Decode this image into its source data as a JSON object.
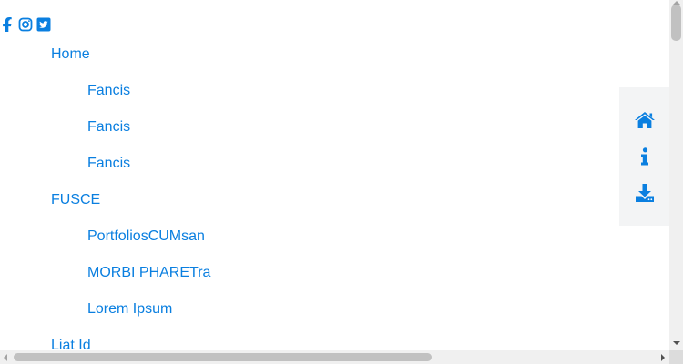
{
  "social": {
    "icons": [
      "facebook-icon",
      "instagram-icon",
      "twitter-icon"
    ],
    "color": "#0a7fe0"
  },
  "nav": {
    "home": {
      "label": "Home",
      "children": [
        "Fancis",
        "Fancis",
        "Fancis"
      ]
    },
    "fusce": {
      "label": "FUSCE",
      "children": [
        "PortfoliosCUMsan",
        "MORBI PHARETra",
        "Lorem Ipsum"
      ]
    },
    "liat": {
      "label": "Liat Id"
    }
  },
  "side_panel": {
    "icons": [
      "home-icon",
      "info-icon",
      "download-icon"
    ],
    "icon_color": "#0a7fe0",
    "background": "#f3f4f5"
  },
  "colors": {
    "link": "#0a7fe0",
    "scrollbar_track": "#f0f0f0",
    "scrollbar_thumb": "#c1c1c1"
  }
}
